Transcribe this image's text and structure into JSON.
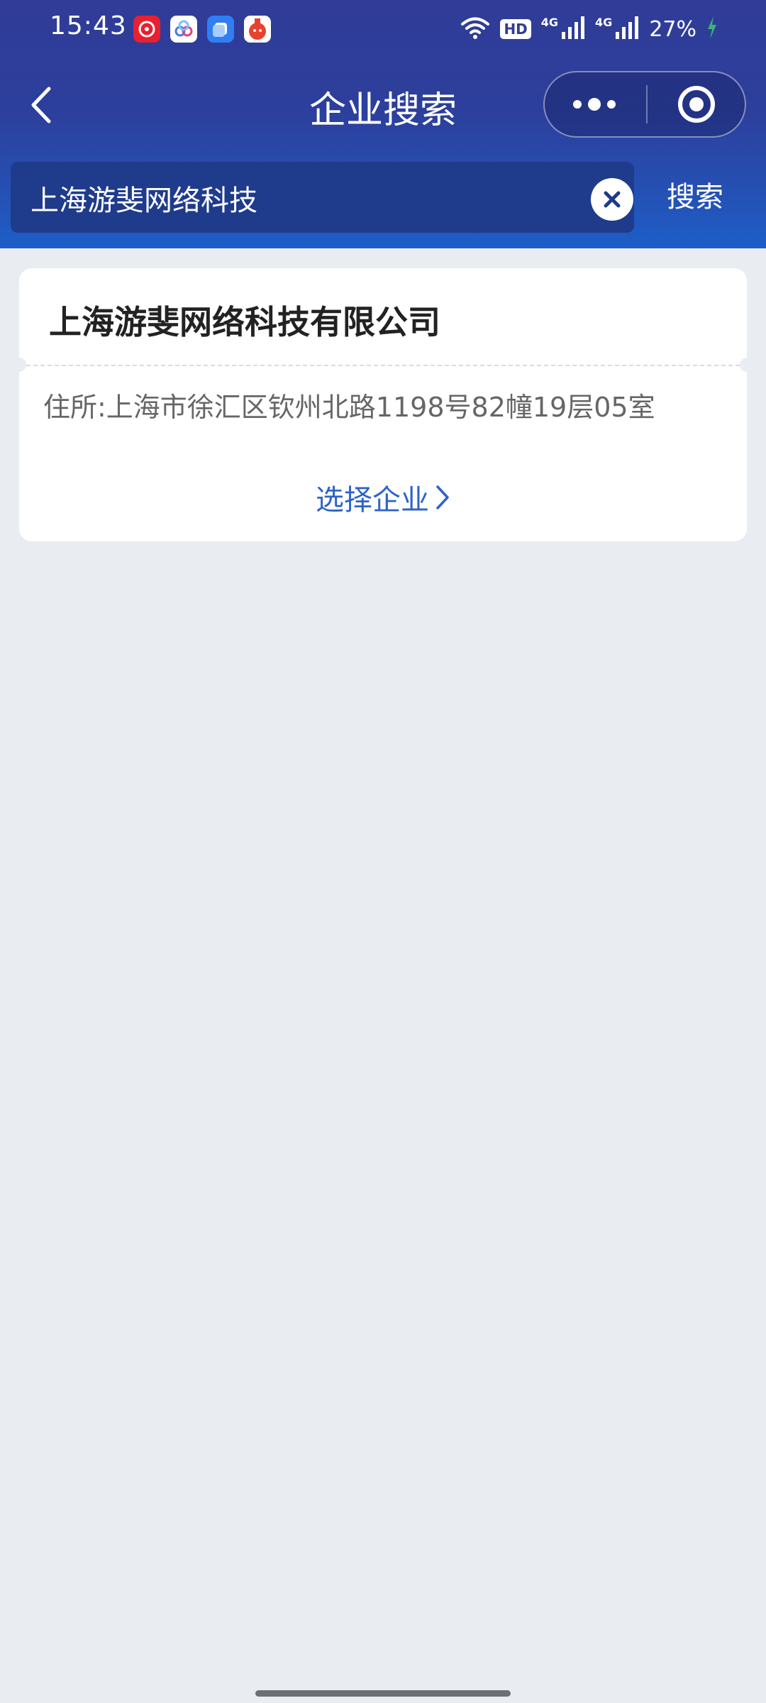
{
  "status_bar": {
    "time": "15:43",
    "hd_label": "HD",
    "network_label_1": "4G",
    "network_label_2": "4G",
    "battery": "27%",
    "app_icons": [
      "netease-music-icon",
      "cloud-app-icon",
      "blue-square-app-icon",
      "red-mascot-app-icon"
    ]
  },
  "nav": {
    "title": "企业搜索"
  },
  "search": {
    "value": "上海游斐网络科技",
    "button_label": "搜索"
  },
  "result": {
    "company_name": "上海游斐网络科技有限公司",
    "address": "住所:上海市徐汇区钦州北路1198号82幢19层05室",
    "select_label": "选择企业"
  },
  "colors": {
    "header_top": "#303c97",
    "header_bottom": "#1d5ec8",
    "link": "#2d63c8",
    "page_bg": "#e9ecf1"
  }
}
